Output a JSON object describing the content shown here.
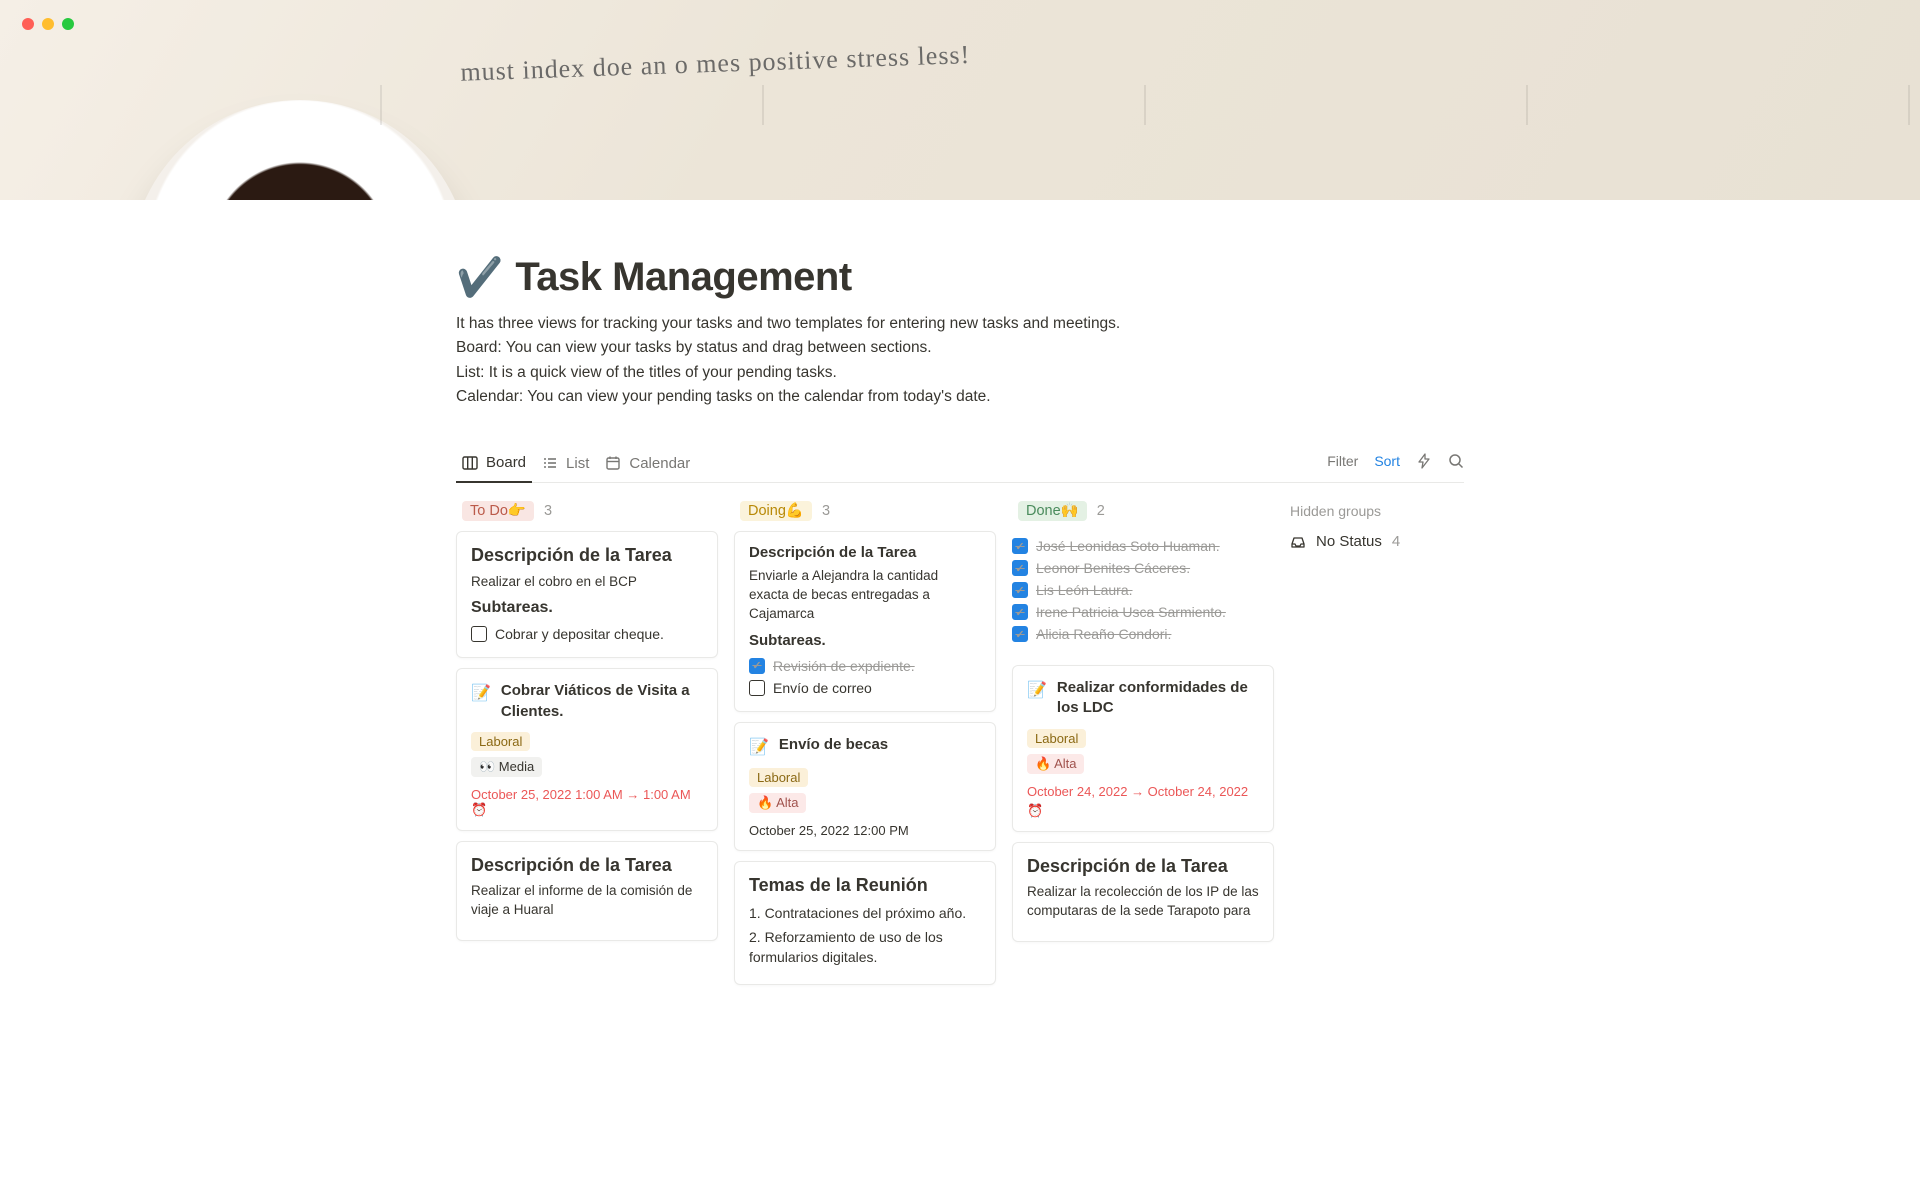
{
  "cover_scribble": "must index    doe an    o mes positive    stress less!",
  "title_icon": "✔️",
  "title": "Task Management",
  "description": [
    "It has three views for tracking your tasks and two templates for entering new tasks and meetings.",
    "Board: You can view your tasks by status and drag between sections.",
    "List: It is a quick view of the titles of your pending tasks.",
    "Calendar: You can view your pending tasks on the calendar from today's date."
  ],
  "views": {
    "board": "Board",
    "list": "List",
    "calendar": "Calendar"
  },
  "controls": {
    "filter": "Filter",
    "sort": "Sort"
  },
  "columns": {
    "todo": {
      "label": "To Do👉",
      "count": "3"
    },
    "doing": {
      "label": "Doing💪",
      "count": "3"
    },
    "done": {
      "label": "Done🙌",
      "count": "2"
    }
  },
  "hidden_groups": {
    "title": "Hidden groups",
    "no_status": "No Status",
    "count": "4"
  },
  "todo": {
    "c1_title": "Descripción de la Tarea",
    "c1_desc": "Realizar el cobro en el BCP",
    "c1_sub_h": "Subtareas.",
    "c1_check1": "Cobrar y depositar cheque.",
    "c2_title": "Cobrar Viáticos de Visita a Clientes.",
    "c2_tag1": "Laboral",
    "c2_tag2": "👀 Media",
    "c2_date": "October 25, 2022 1:00 AM → 1:00 AM ⏰",
    "c3_title": "Descripción de la Tarea",
    "c3_desc": "Realizar el informe de la comisión de viaje a Huaral"
  },
  "doing": {
    "c1_title": "Descripción de la Tarea",
    "c1_desc": "Enviarle a Alejandra la cantidad exacta de becas entregadas a Cajamarca",
    "c1_sub_h": "Subtareas.",
    "c1_check1": "Revisión de expdiente.",
    "c1_check2": "Envío de correo",
    "c2_title": "Envío de becas",
    "c2_tag1": "Laboral",
    "c2_tag2": "🔥 Alta",
    "c2_date": "October 25, 2022 12:00 PM",
    "c3_title": "Temas de la Reunión",
    "c3_item1": "1. Contrataciones del próximo año.",
    "c3_item2": "2. Reforzamiento de uso de los formularios digitales."
  },
  "done": {
    "c1_check1": "José Leonidas Soto Huaman.",
    "c1_check2": "Leonor Benites Cáceres.",
    "c1_check3": "Lis León Laura.",
    "c1_check4": "Irene Patricia Usca Sarmiento.",
    "c1_check5": "Alicia Reaño Condori.",
    "c2_title": "Realizar conformidades de los LDC",
    "c2_tag1": "Laboral",
    "c2_tag2": "🔥 Alta",
    "c2_date1": "October 24, 2022 → October 24, 2022",
    "c2_date2": "⏰",
    "c3_title": "Descripción de la Tarea",
    "c3_desc": "Realizar la recolección de los IP de las computaras de la sede Tarapoto para"
  }
}
